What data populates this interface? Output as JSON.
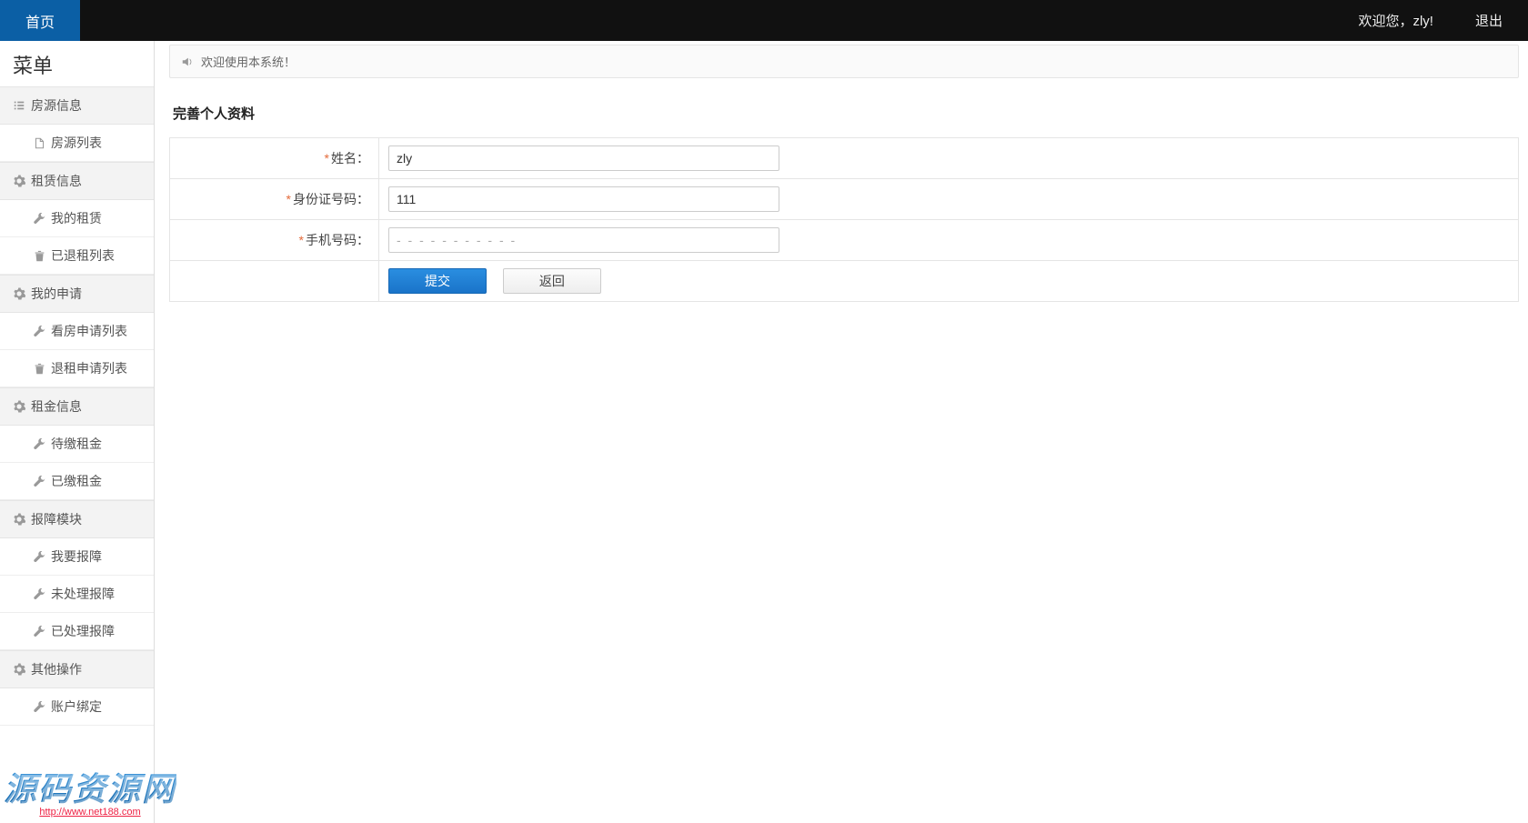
{
  "topbar": {
    "home": "首页",
    "welcome": "欢迎您，zly!",
    "logout": "退出"
  },
  "sidebar": {
    "title": "菜单",
    "groups": [
      {
        "label": "房源信息",
        "icon": "list",
        "items": [
          {
            "label": "房源列表",
            "icon": "file"
          }
        ]
      },
      {
        "label": "租赁信息",
        "icon": "gear",
        "items": [
          {
            "label": "我的租赁",
            "icon": "wrench"
          },
          {
            "label": "已退租列表",
            "icon": "trash"
          }
        ]
      },
      {
        "label": "我的申请",
        "icon": "gear",
        "items": [
          {
            "label": "看房申请列表",
            "icon": "wrench"
          },
          {
            "label": "退租申请列表",
            "icon": "trash"
          }
        ]
      },
      {
        "label": "租金信息",
        "icon": "gear",
        "items": [
          {
            "label": "待缴租金",
            "icon": "wrench"
          },
          {
            "label": "已缴租金",
            "icon": "wrench"
          }
        ]
      },
      {
        "label": "报障模块",
        "icon": "gear",
        "items": [
          {
            "label": "我要报障",
            "icon": "wrench"
          },
          {
            "label": "未处理报障",
            "icon": "wrench"
          },
          {
            "label": "已处理报障",
            "icon": "wrench"
          }
        ]
      },
      {
        "label": "其他操作",
        "icon": "gear",
        "items": [
          {
            "label": "账户绑定",
            "icon": "wrench"
          }
        ]
      }
    ]
  },
  "notice": "欢迎使用本系统！",
  "page": {
    "heading": "完善个人资料",
    "fields": {
      "name": {
        "label": "姓名：",
        "value": "zly"
      },
      "idno": {
        "label": "身份证号码：",
        "value": "111"
      },
      "phone": {
        "label": "手机号码：",
        "placeholder": "- - - - - - - - - - -",
        "value": ""
      }
    },
    "buttons": {
      "submit": "提交",
      "back": "返回"
    }
  },
  "watermark": {
    "main": "源码资源网",
    "url": "http://www.net188.com"
  }
}
